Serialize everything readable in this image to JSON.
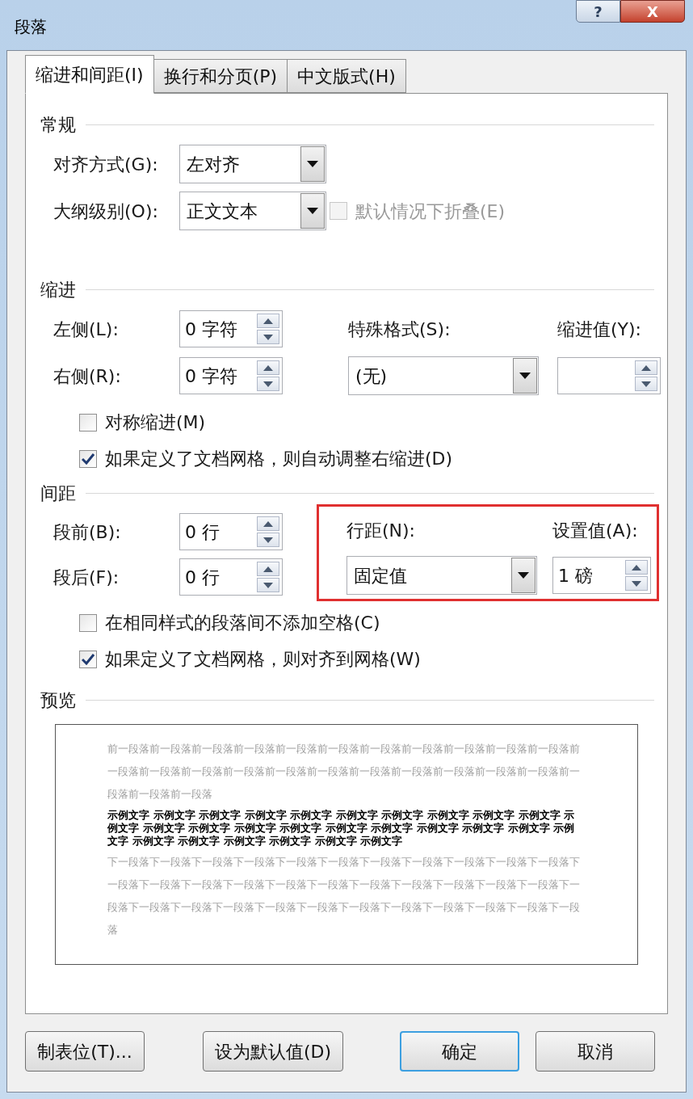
{
  "window": {
    "title": "段落",
    "buttons": [
      "?",
      "X"
    ]
  },
  "tabs": [
    {
      "label": "缩进和间距(I)",
      "selected": true
    },
    {
      "label": "换行和分页(P)",
      "selected": false
    },
    {
      "label": "中文版式(H)",
      "selected": false
    }
  ],
  "general": {
    "title": "常规",
    "alignment": {
      "label": "对齐方式(G):",
      "value": "左对齐"
    },
    "outline_level": {
      "label": "大纲级别(O):",
      "value": "正文文本"
    },
    "collapse": {
      "label": "默认情况下折叠(E)",
      "checked": false,
      "disabled": true
    }
  },
  "indent": {
    "title": "缩进",
    "left": {
      "label": "左侧(L):",
      "value": "0 字符"
    },
    "right": {
      "label": "右侧(R):",
      "value": "0 字符"
    },
    "special": {
      "label": "特殊格式(S):",
      "value": "(无)"
    },
    "by": {
      "label": "缩进值(Y):"
    },
    "checkboxes": [
      {
        "label": "对称缩进(M)",
        "checked": false
      },
      {
        "label": "如果定义了文档网格，则自动调整右缩进(D)",
        "checked": true
      }
    ]
  },
  "spacing": {
    "title": "间距",
    "before": {
      "label": "段前(B):",
      "value": "0 行"
    },
    "after": {
      "label": "段后(F):",
      "value": "0 行"
    },
    "line_spacing": {
      "label": "行距(N):",
      "value": "固定值"
    },
    "at": {
      "label": "设置值(A):",
      "value": "1 磅"
    },
    "highlighted": true,
    "checkboxes": [
      {
        "label": "在相同样式的段落间不添加空格(C)",
        "checked": false
      },
      {
        "label": "如果定义了文档网格，则对齐到网格(W)",
        "checked": true
      }
    ]
  },
  "preview": {
    "title": "预览",
    "previous": "前一段落前一段落前一段落前一段落前一段落前一段落前一段落前一段落前一段落前一段落前一段落前一段落前一段落前一段落前一段落前一段落前一段落前一段落前一段落前一段落前一段落前一段落前一段落前一段落前一段落",
    "sample": "示例文字 示例文字 示例文字 示例文字 示例文字 示例文字 示例文字 示例文字 示例文字 示例文字 示例文字 示例文字 示例文字 示例文字 示例文字 示例文字 示例文字 示例文字 示例文字 示例文字 示例文字 示例文字 示例文字 示例文字 示例文字 示例文字 示例文字",
    "next": "下一段落下一段落下一段落下一段落下一段落下一段落下一段落下一段落下一段落下一段落下一段落下一段落下一段落下一段落下一段落下一段落下一段落下一段落下一段落下一段落下一段落下一段落下一段落下一段落下一段落下一段落下一段落下一段落下一段落下一段落下一段落下一段落下一段落下一段落"
  },
  "buttons": [
    {
      "label": "制表位(T)...",
      "kind": "normal"
    },
    {
      "label": "设为默认值(D)",
      "kind": "normal"
    },
    {
      "label": "确定",
      "kind": "default"
    },
    {
      "label": "取消",
      "kind": "normal"
    }
  ]
}
